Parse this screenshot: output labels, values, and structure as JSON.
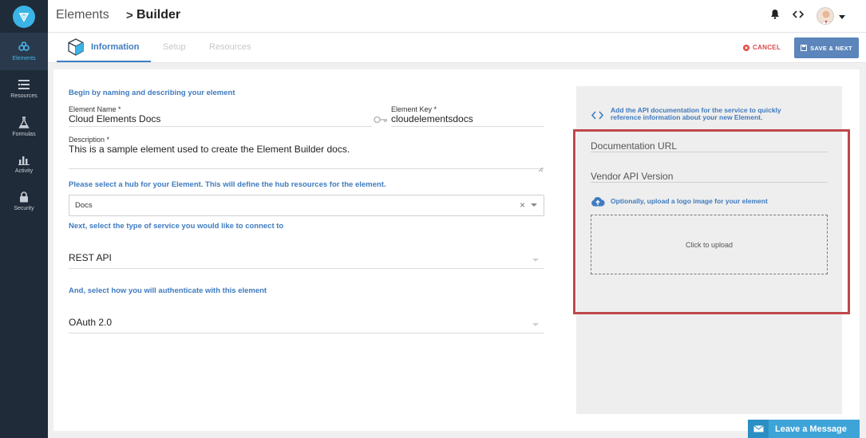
{
  "app": {
    "crumb_root": "Elements",
    "crumb_sep": ">",
    "crumb_current": "Builder"
  },
  "sidebar": {
    "items": [
      {
        "label": "Elements",
        "icon": "elements-icon",
        "active": true
      },
      {
        "label": "Resources",
        "icon": "resources-icon",
        "active": false
      },
      {
        "label": "Formulas",
        "icon": "formulas-icon",
        "active": false
      },
      {
        "label": "Activity",
        "icon": "activity-icon",
        "active": false
      },
      {
        "label": "Security",
        "icon": "lock-icon",
        "active": false
      }
    ]
  },
  "tabs": [
    {
      "label": "Information",
      "active": true
    },
    {
      "label": "Setup",
      "active": false
    },
    {
      "label": "Resources",
      "active": false
    }
  ],
  "actions": {
    "cancel": "CANCEL",
    "save": "SAVE & NEXT"
  },
  "form": {
    "intro": "Begin by naming and describing your element",
    "name_label": "Element Name *",
    "name_value": "Cloud Elements Docs",
    "key_label": "Element Key *",
    "key_value": "cloudelementsdocs",
    "desc_label": "Description *",
    "desc_value": "This is a sample element used to create the Element Builder docs.",
    "hub_prompt": "Please select a hub for your Element. This will define the hub resources for the element.",
    "hub_value": "Docs",
    "hub_clear": "×",
    "service_prompt": "Next, select the type of service you would like to connect to",
    "service_value": "REST API",
    "auth_prompt": "And, select how you will authenticate with this element",
    "auth_value": "OAuth 2.0"
  },
  "panel": {
    "api_doc_line1": "Add the API documentation for the service to quickly",
    "api_doc_line2": "reference information about your new Element.",
    "doc_url": "Documentation URL",
    "vendor_version": "Vendor API Version",
    "upload_hint": "Optionally, upload a logo image for your element",
    "upload_cta": "Click to upload"
  },
  "chat": {
    "label": "Leave a Message"
  },
  "colors": {
    "accent": "#3f7bbf",
    "sidebar": "#1f2b38",
    "cancel": "#e0484a",
    "save": "#5b85bb",
    "highlight": "#c0474c",
    "chat": "#3ea4d8"
  }
}
